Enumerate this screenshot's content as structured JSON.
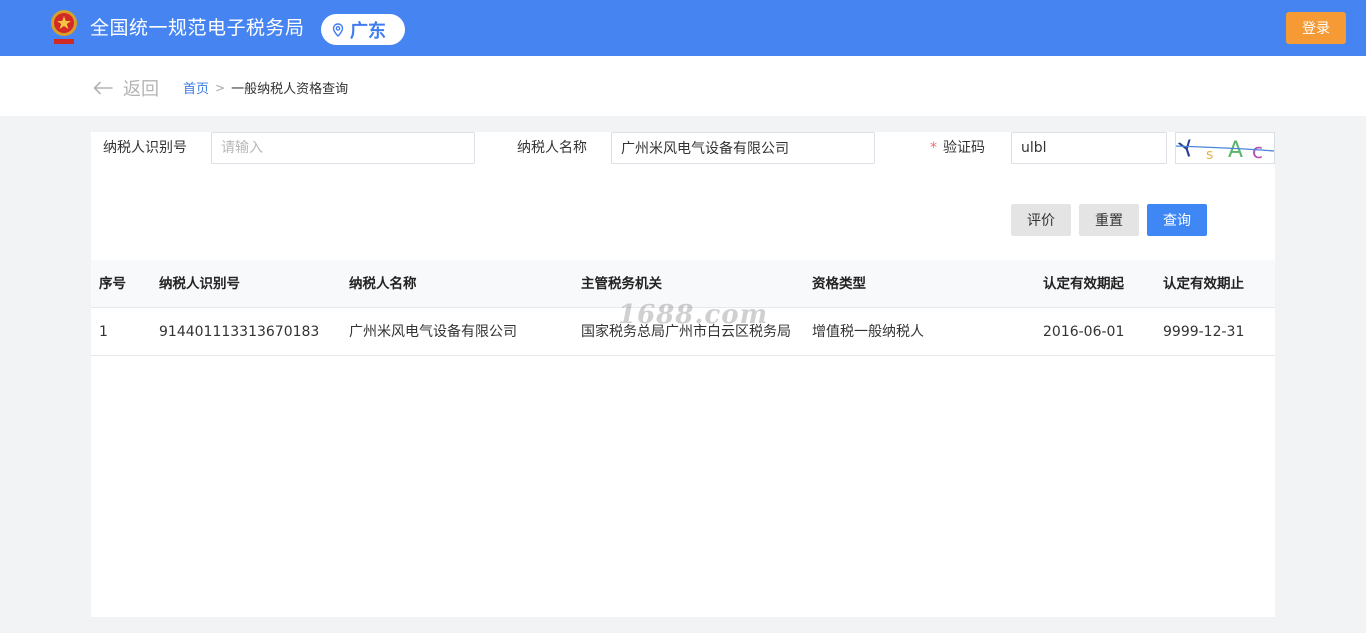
{
  "header": {
    "title": "全国统一规范电子税务局",
    "region": "广东",
    "login_label": "登录"
  },
  "nav": {
    "back_label": "返回",
    "breadcrumb_home": "首页",
    "breadcrumb_separator": ">",
    "breadcrumb_current": "一般纳税人资格查询"
  },
  "form": {
    "taxpayer_id_label": "纳税人识别号",
    "taxpayer_id_placeholder": "请输入",
    "taxpayer_id_value": "",
    "taxpayer_name_label": "纳税人名称",
    "taxpayer_name_value": "广州米风电气设备有限公司",
    "captcha_required_mark": "*",
    "captcha_label": "验证码",
    "captcha_value": "ulbl",
    "captcha_image_text": "YsAc",
    "buttons": {
      "evaluate": "评价",
      "reset": "重置",
      "query": "查询"
    }
  },
  "table": {
    "columns": [
      "序号",
      "纳税人识别号",
      "纳税人名称",
      "主管税务机关",
      "资格类型",
      "认定有效期起",
      "认定有效期止"
    ],
    "rows": [
      [
        "1",
        "914401113313670183",
        "广州米风电气设备有限公司",
        "国家税务总局广州市白云区税务局",
        "增值税一般纳税人",
        "2016-06-01",
        "9999-12-31"
      ]
    ]
  },
  "watermark": "1688.com",
  "colors": {
    "header_bg": "#4684f2",
    "login_button": "#f59a34",
    "query_button": "#3f87f5",
    "link": "#3a7ae0",
    "required": "#f56c6c"
  },
  "icons": {
    "logo": "tax-emblem-icon",
    "region": "location-pin-icon",
    "back": "arrow-left-icon",
    "breadcrumb": "chevron-right-icon"
  }
}
